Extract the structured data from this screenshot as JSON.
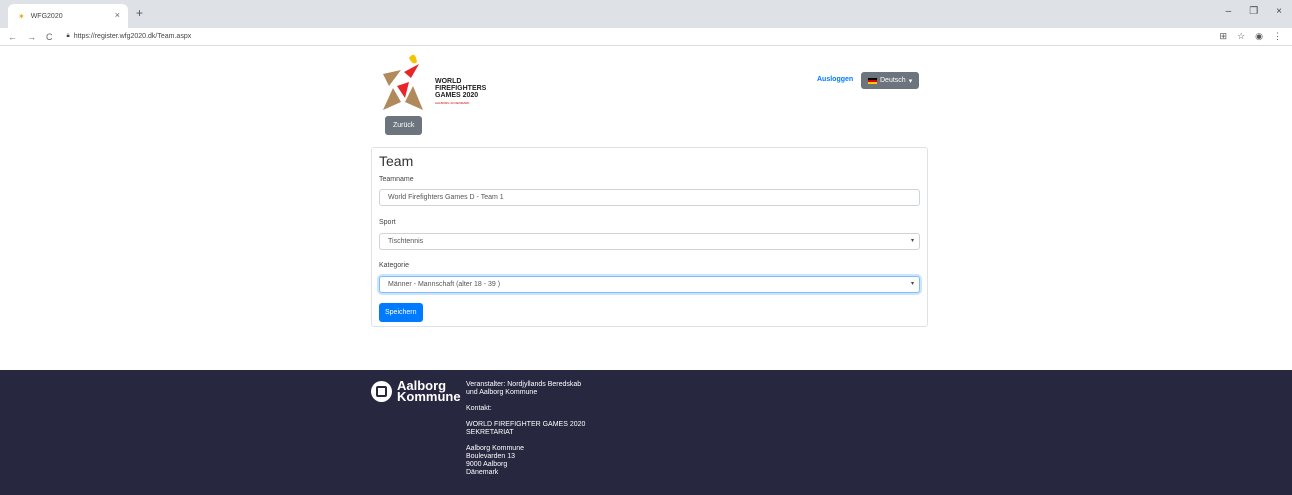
{
  "browser": {
    "tab_title": "WFG2020",
    "tab_close": "×",
    "new_tab": "+",
    "nav_back": "←",
    "nav_forward": "→",
    "nav_reload": "C",
    "url": "https://register.wfg2020.dk/Team.aspx",
    "window_minimize": "–",
    "window_restore": "❐",
    "window_close": "×"
  },
  "header": {
    "logo_lines": [
      "WORLD",
      "FIREFIGHTERS",
      "GAMES 2020"
    ],
    "logo_sub": "AALBORG 20 DENMARK",
    "back_label": "Zurück",
    "logout_label": "Ausloggen",
    "language_label": "Deutsch"
  },
  "form": {
    "title": "Team",
    "teamname_label": "Teamname",
    "teamname_value": "World Firefighters Games D - Team 1",
    "sport_label": "Sport",
    "sport_value": "Tischtennis",
    "category_label": "Kategorie",
    "category_value": "Männer - Mannschaft (alter 18 - 39 )",
    "save_label": "Speichern"
  },
  "footer": {
    "org_name_line1": "Aalborg",
    "org_name_line2": "Kommune",
    "organizer": "Veranstalter: Nordjyllands Beredskab und Aalborg Kommune",
    "contact_label": "Kontakt:",
    "secretariat": "WORLD FIREFIGHTER GAMES 2020 SEKRETARIAT",
    "address_line1": "Aalborg Kommune",
    "address_line2": "Boulevarden 13",
    "address_line3": "9000 Aalborg",
    "address_line4": "Dänemark"
  },
  "colors": {
    "primary": "#007bff",
    "secondary": "#6c757d",
    "footer_bg": "#27273f"
  }
}
